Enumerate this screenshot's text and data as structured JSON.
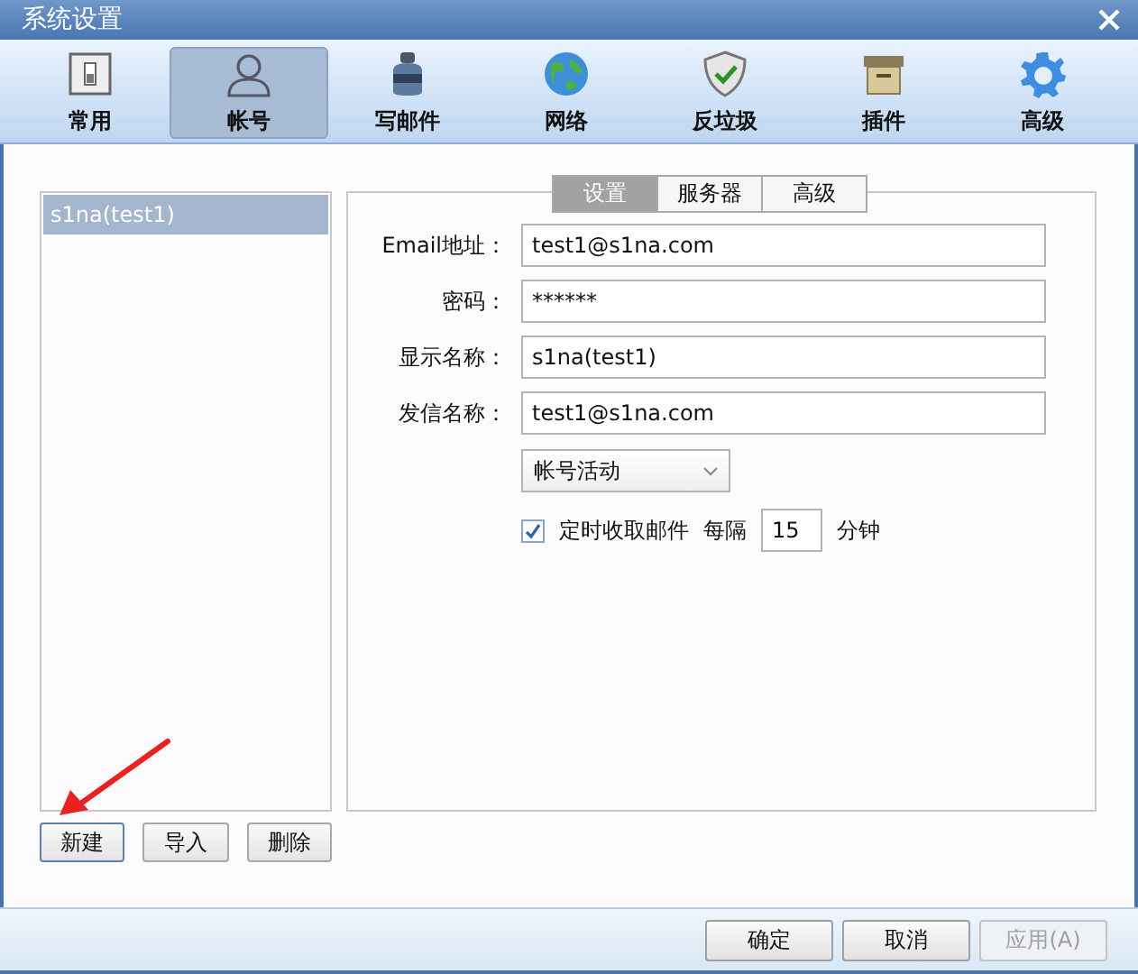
{
  "window": {
    "title": "系统设置"
  },
  "toolbar": [
    {
      "label": "常用",
      "selected": false
    },
    {
      "label": "帐号",
      "selected": true
    },
    {
      "label": "写邮件",
      "selected": false
    },
    {
      "label": "网络",
      "selected": false
    },
    {
      "label": "反垃圾",
      "selected": false
    },
    {
      "label": "插件",
      "selected": false
    },
    {
      "label": "高级",
      "selected": false
    }
  ],
  "accounts": {
    "items": [
      {
        "label": "s1na(test1)",
        "selected": true
      }
    ],
    "buttons": [
      {
        "label": "新建",
        "focused": true
      },
      {
        "label": "导入",
        "focused": false
      },
      {
        "label": "删除",
        "focused": false
      }
    ]
  },
  "settings": {
    "tabs": [
      {
        "label": "设置",
        "selected": true
      },
      {
        "label": "服务器",
        "selected": false
      },
      {
        "label": "高级",
        "selected": false
      }
    ],
    "fields": [
      {
        "label": "Email地址：",
        "value": "test1@s1na.com"
      },
      {
        "label": "密码：",
        "value": "******"
      },
      {
        "label": "显示名称：",
        "value": "s1na(test1)"
      },
      {
        "label": "发信名称：",
        "value": "test1@s1na.com"
      }
    ],
    "dropdown": {
      "value": "帐号活动"
    },
    "auto_fetch": {
      "label": "定时收取邮件",
      "checked": true,
      "interval_label": "每隔",
      "interval": "15",
      "unit": "分钟"
    }
  },
  "footer": {
    "buttons": [
      {
        "label": "确定",
        "disabled": false
      },
      {
        "label": "取消",
        "disabled": false
      },
      {
        "label": "应用(A)",
        "disabled": true
      }
    ]
  }
}
